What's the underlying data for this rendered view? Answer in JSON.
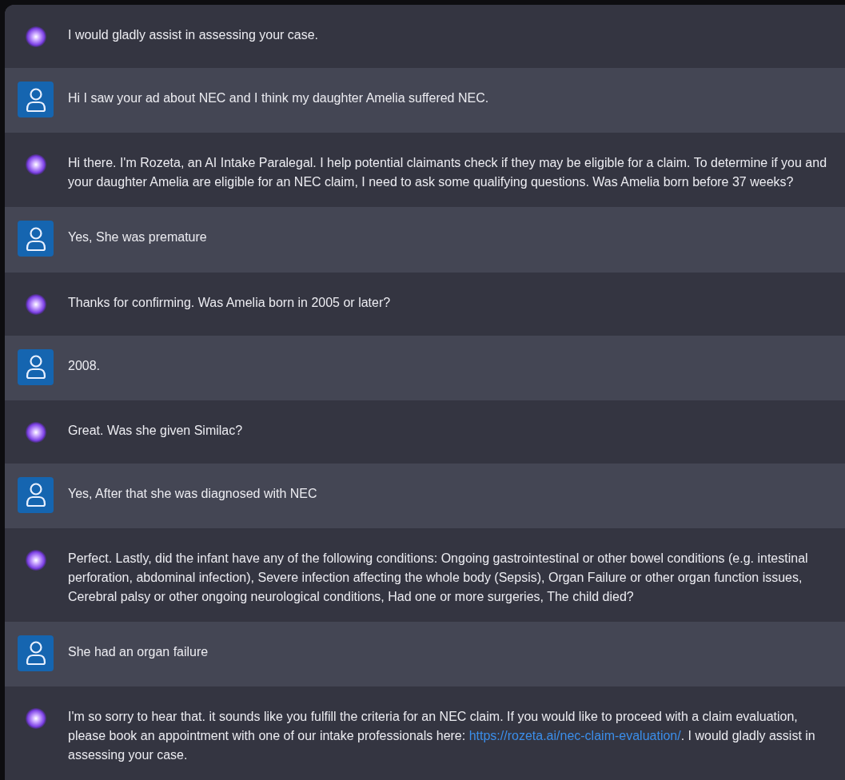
{
  "messages": [
    {
      "kind": "assistant",
      "text": "I would gladly assist in assessing your case."
    },
    {
      "kind": "user",
      "text": "Hi I saw your ad about NEC and I think my daughter Amelia suffered NEC."
    },
    {
      "kind": "assistant",
      "text": "Hi there. I'm Rozeta, an AI Intake Paralegal. I help potential claimants check if they may be eligible for a claim. To determine if you and your daughter Amelia are eligible for an NEC claim, I need to ask some qualifying questions. Was Amelia born before 37 weeks?"
    },
    {
      "kind": "user",
      "text": "Yes, She was premature"
    },
    {
      "kind": "assistant",
      "text": "Thanks for confirming. Was Amelia born in 2005 or later?"
    },
    {
      "kind": "user",
      "text": "2008."
    },
    {
      "kind": "assistant",
      "text": "Great. Was she given Similac?"
    },
    {
      "kind": "user",
      "text": "Yes, After that she was diagnosed with NEC"
    },
    {
      "kind": "assistant",
      "text": "Perfect. Lastly, did the infant have any of the following conditions: Ongoing gastrointestinal or other bowel conditions (e.g. intestinal perforation, abdominal infection), Severe infection affecting the whole body (Sepsis), Organ Failure or other organ function issues, Cerebral palsy or other ongoing neurological conditions, Had one or more surgeries, The child died?"
    },
    {
      "kind": "user",
      "text": "She had an organ failure"
    },
    {
      "kind": "assistant",
      "text": "I'm so sorry to hear that. it sounds like you fulfill the criteria for an NEC claim. If you would like to proceed with a claim evaluation, please book an appointment with one of our intake professionals here: ",
      "link": "https://rozeta.ai/nec-claim-evaluation/",
      "text_after": ". I would gladly assist in assessing your case."
    }
  ]
}
